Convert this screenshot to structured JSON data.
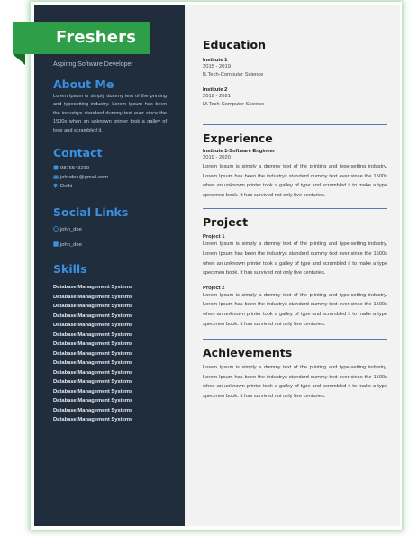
{
  "ribbon_label": "Freshers",
  "sidebar": {
    "subtitle": "Aspiring Software Developer",
    "about": {
      "heading": "About Me",
      "text": "Lorem Ipsum is simply dummy text of the printing and typesetting industry. Lorem Ipsum has been the industrys standard dummy text ever since the 1500s when an unknown printer took a galley of type and scrambled it."
    },
    "contact": {
      "heading": "Contact",
      "phone": "9876543210",
      "email": "johndoe@gmail.com",
      "location": "Delhi",
      "icons": [
        "phone-icon",
        "mail-icon",
        "location-pin-icon"
      ]
    },
    "social": {
      "heading": "Social Links",
      "items": [
        {
          "icon": "github-icon",
          "label": "john_doe"
        },
        {
          "icon": "linkedin-icon",
          "label": "john_doe"
        }
      ]
    },
    "skills": {
      "heading": "Skills",
      "items": [
        "Database Management Systems",
        "Database Management Systems",
        "Database Management Systems",
        "Database Management Systems",
        "Database Management Systems",
        "Database Management Systems",
        "Database Management Systems",
        "Database Management Systems",
        "Database Management Systems",
        "Database Management Systems",
        "Database Management Systems",
        "Database Management Systems",
        "Database Management Systems",
        "Database Management Systems",
        "Database Management Systems"
      ]
    }
  },
  "main": {
    "education": {
      "heading": "Education",
      "items": [
        {
          "name": "Institute 1",
          "years": "2015 - 2019",
          "degree": "B.Tech-Computer Science"
        },
        {
          "name": "Institute 2",
          "years": "2019 - 2021",
          "degree": "M.Tech-Computer Science"
        }
      ]
    },
    "experience": {
      "heading": "Experience",
      "role": "Institute 1-Software Engineer",
      "years": "2019 - 2020",
      "text": "Lorem Ipsum is simply a dummy text of the printing and type-setting industry. Lorem Ipsum has been the industrys standard dummy text ever since the 1500s when an unknown printer took a galley of type and scrambled it to make a type specimen book. It has survived not only five centuries."
    },
    "project": {
      "heading": "Project",
      "items": [
        {
          "name": "Project 1",
          "text": "Lorem Ipsum is simply a dummy text of the printing and type-setting industry. Lorem Ipsum has been the industrys standard dummy text ever since the 1500s when an unknown printer took a galley of type and scrambled it to make a type specimen book. It has survived not only five centuries."
        },
        {
          "name": "Project 2",
          "text": "Lorem Ipsum is simply a dummy text of the printing and type-setting industry. Lorem Ipsum has been the industrys standard dummy text ever since the 1500s when an unknown printer took a galley of type and scrambled it to make a type specimen book. It has survived not only five centuries."
        }
      ]
    },
    "achievements": {
      "heading": "Achievements",
      "text": "Lorem Ipsum is simply a dummy text of the printing and type-setting industry. Lorem Ipsum has been the industrys standard dummy text ever since the 1500s when an unknown printer took a galley of type and scrambled it to make a type specimen book. It has survived not only five centuries."
    }
  },
  "colors": {
    "sidebar_bg": "#1f2d3d",
    "accent_blue": "#3b8fe0",
    "ribbon_green": "#2e9e48",
    "main_bg": "#f2f2f2"
  }
}
